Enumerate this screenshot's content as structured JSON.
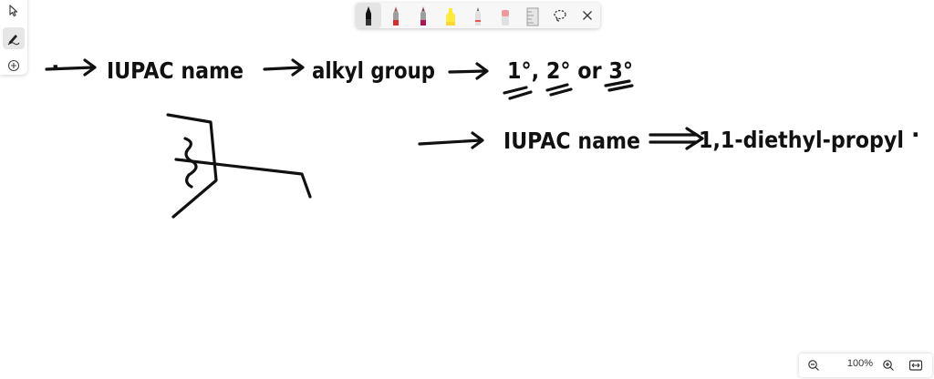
{
  "canvas": {
    "line1": {
      "dot": ".",
      "term1": "IUPAC name",
      "term2": "alkyl group",
      "term3": "1°, 2° or 3°"
    },
    "line2": {
      "term1": "IUPAC name",
      "term2": "1,1-diethyl-propyl",
      "trailing_dot": "."
    }
  },
  "left_toolbar": [
    {
      "name": "select-icon"
    },
    {
      "name": "draw-pen-icon",
      "active": true
    },
    {
      "name": "add-icon"
    }
  ],
  "pen_toolbar": {
    "tools": [
      {
        "name": "black-pen",
        "color": "#111111",
        "selected": true
      },
      {
        "name": "red-pen",
        "color": "#d32f2f"
      },
      {
        "name": "crimson-pen",
        "color": "#ad1457"
      },
      {
        "name": "yellow-highlighter",
        "color": "#ffeb3b"
      },
      {
        "name": "pencil",
        "color": "#cfcfcf"
      },
      {
        "name": "eraser",
        "color": "#ef9a9a"
      },
      {
        "name": "ruler",
        "color": "#bdbdbd"
      },
      {
        "name": "lasso-select",
        "icon": "lasso-icon"
      },
      {
        "name": "close",
        "icon": "close-icon"
      }
    ]
  },
  "zoom": {
    "level": "100%",
    "zoom_out_icon": "zoom-out-icon",
    "zoom_in_icon": "zoom-in-icon",
    "fit_icon": "fit-width-icon"
  }
}
